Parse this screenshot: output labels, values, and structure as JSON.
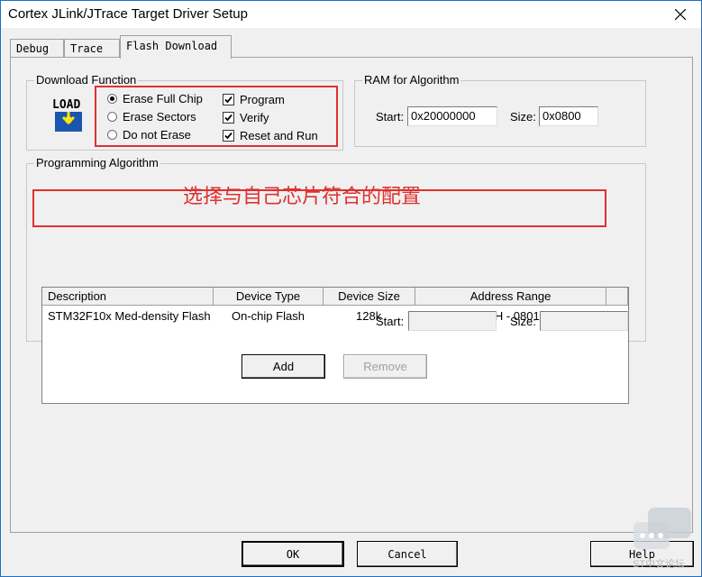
{
  "window": {
    "title": "Cortex JLink/JTrace Target Driver Setup"
  },
  "tabs": [
    {
      "label": "Debug",
      "active": false
    },
    {
      "label": "Trace",
      "active": false
    },
    {
      "label": "Flash Download",
      "active": true
    }
  ],
  "download_function": {
    "label": "Download Function",
    "icon": "load-icon",
    "icon_text": "LOAD",
    "radios": [
      {
        "label": "Erase Full Chip",
        "selected": true
      },
      {
        "label": "Erase Sectors",
        "selected": false
      },
      {
        "label": "Do not Erase",
        "selected": false
      }
    ],
    "checks": [
      {
        "label": "Program",
        "checked": true
      },
      {
        "label": "Verify",
        "checked": true
      },
      {
        "label": "Reset and Run",
        "checked": true
      }
    ]
  },
  "ram_for_algorithm": {
    "label": "RAM for Algorithm",
    "start_label": "Start:",
    "start_value": "0x20000000",
    "size_label": "Size:",
    "size_value": "0x0800"
  },
  "programming_algorithm": {
    "label": "Programming Algorithm",
    "columns": [
      "Description",
      "Device Type",
      "Device Size",
      "Address Range"
    ],
    "rows": [
      [
        "STM32F10x Med-density Flash",
        "On-chip Flash",
        "128k",
        "08000000H - 0801FFFFH"
      ]
    ],
    "start_label": "Start:",
    "start_value": "",
    "size_label": "Size:",
    "size_value": ""
  },
  "annotation": "选择与自己芯片符合的配置",
  "buttons": {
    "add": "Add",
    "remove": "Remove",
    "ok": "OK",
    "cancel": "Cancel",
    "help": "Help"
  },
  "watermark": "ST中文论坛",
  "colors": {
    "annotation_red": "#e03030",
    "window_border": "#1d6fc4"
  }
}
